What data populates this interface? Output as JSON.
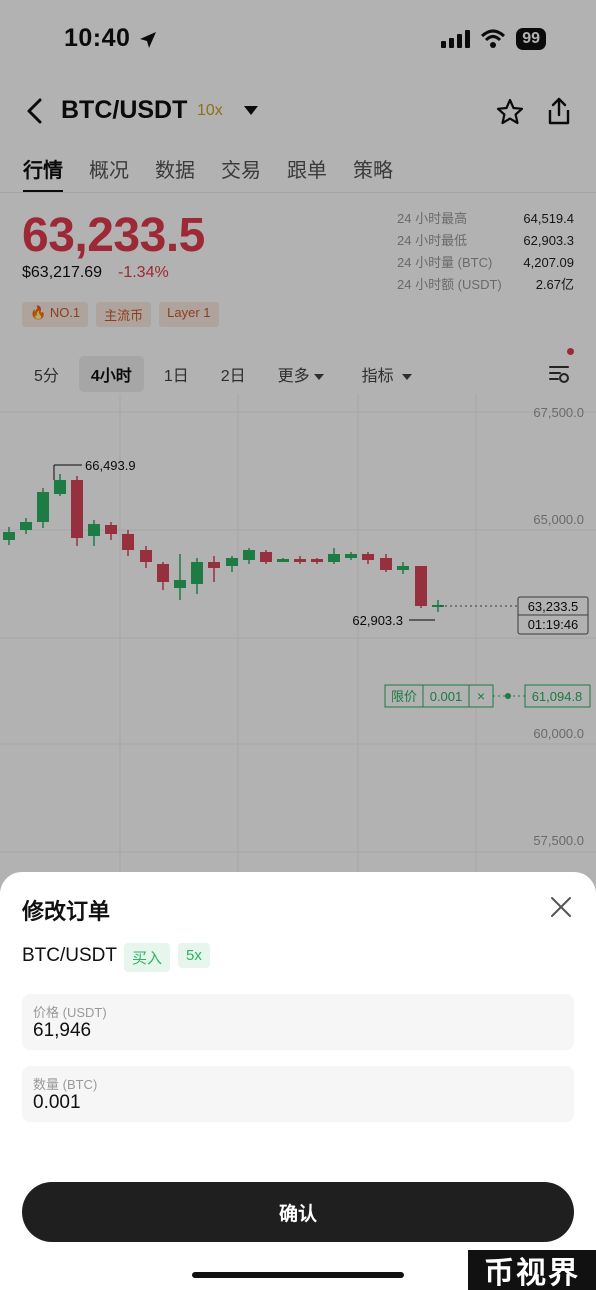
{
  "status": {
    "time": "10:40",
    "battery": "99"
  },
  "header": {
    "pair": "BTC/USDT",
    "leverage": "10x"
  },
  "tabs": [
    "行情",
    "概况",
    "数据",
    "交易",
    "跟单",
    "策略"
  ],
  "price": {
    "last": "63,233.5",
    "usd": "$63,217.69",
    "change": "-1.34%"
  },
  "tags": [
    "NO.1",
    "主流币",
    "Layer 1"
  ],
  "stats": {
    "labels": [
      "24 小时最高",
      "24 小时最低",
      "24 小时量 (BTC)",
      "24 小时额 (USDT)"
    ],
    "values": [
      "64,519.4",
      "62,903.3",
      "4,207.09",
      "2.67亿"
    ]
  },
  "intervals": [
    "5分",
    "4小时",
    "1日",
    "2日",
    "更多",
    "指标"
  ],
  "chart": {
    "y_labels": [
      "67,500.0",
      "65,000.0",
      "60,000.0",
      "57,500.0"
    ],
    "high_label": "66,493.9",
    "low_label": "62,903.3",
    "current_price": "63,233.5",
    "countdown": "01:19:46",
    "limit_label": "限价",
    "limit_qty": "0.001",
    "limit_close": "×",
    "limit_price": "61,094.8",
    "colors": {
      "up": "#2ab161",
      "down": "#d9465a"
    }
  },
  "sheet": {
    "title": "修改订单",
    "pair": "BTC/USDT",
    "side": "买入",
    "leverage": "5x",
    "price_label": "价格 (USDT)",
    "price_value": "61,946",
    "qty_label": "数量 (BTC)",
    "qty_value": "0.001",
    "confirm": "确认"
  },
  "watermark": "币视界"
}
